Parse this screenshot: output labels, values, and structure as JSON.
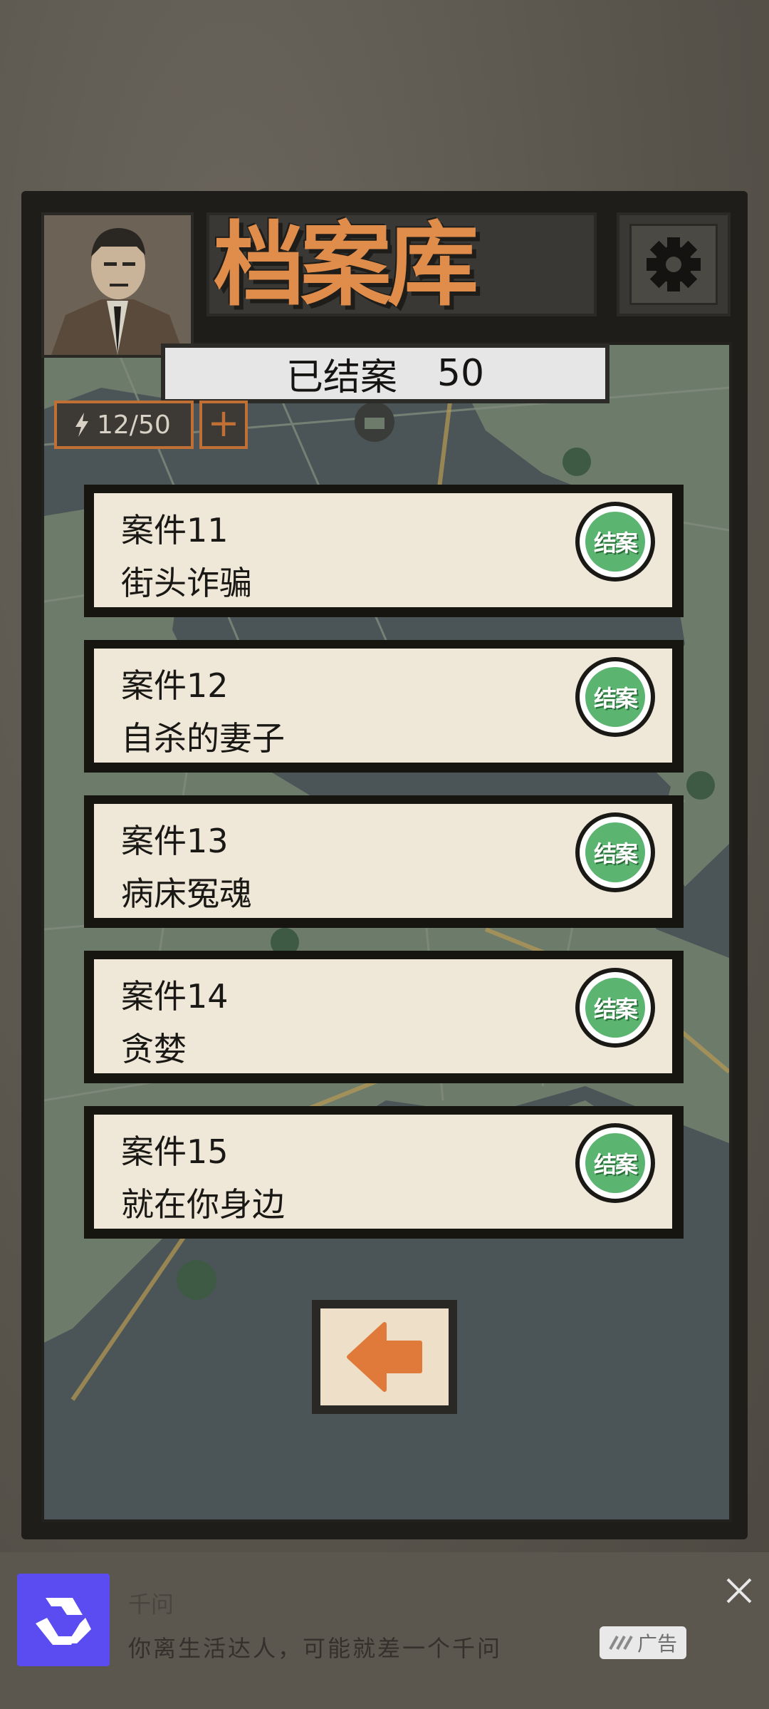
{
  "title": "档案库",
  "closed_banner": {
    "label": "已结案",
    "count": "50"
  },
  "energy": {
    "value": "12/50",
    "plus": "+"
  },
  "cases": [
    {
      "number": "案件11",
      "name": "街头诈骗",
      "stamp": "结案"
    },
    {
      "number": "案件12",
      "name": "自杀的妻子",
      "stamp": "结案"
    },
    {
      "number": "案件13",
      "name": "病床冤魂",
      "stamp": "结案"
    },
    {
      "number": "案件14",
      "name": "贪婪",
      "stamp": "结案"
    },
    {
      "number": "案件15",
      "name": "就在你身边",
      "stamp": "结案"
    }
  ],
  "ad": {
    "app_name": "千问",
    "description": "你离生活达人，可能就差一个千问",
    "tag": "广告"
  },
  "colors": {
    "title": "#e08d4c",
    "stamp_green": "#5bb470",
    "arrow": "#e07a3a",
    "map_water": "#4b5558",
    "map_land": "#6d7b6a"
  },
  "icons": [
    "lightning-icon",
    "gear-icon",
    "factory-icon",
    "tree-icon",
    "back-arrow-icon",
    "close-icon"
  ]
}
